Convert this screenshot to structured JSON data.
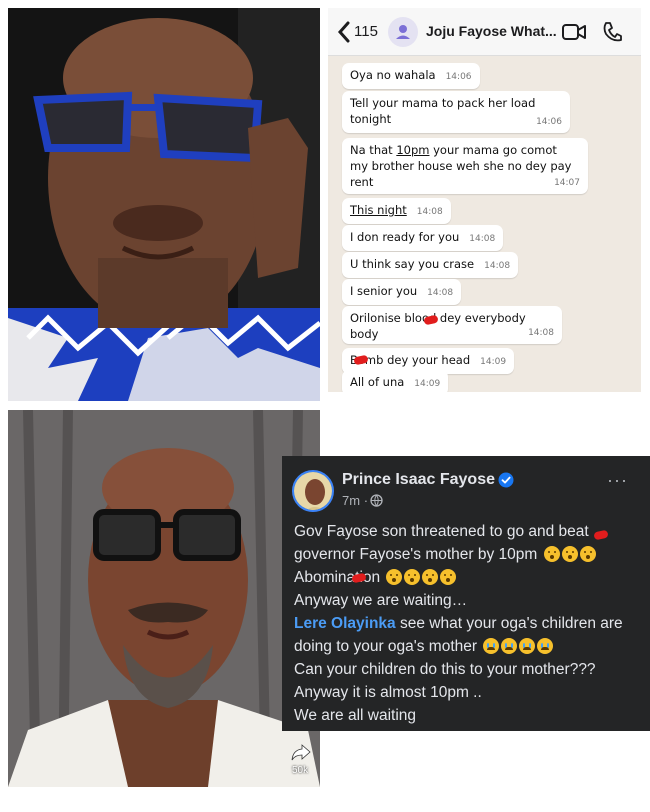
{
  "whatsapp": {
    "back_count": "115",
    "contact_name": "Joju Fayose What...",
    "messages": [
      {
        "text": "Oya no wahala",
        "time": "14:06"
      },
      {
        "text_line1": "Tell your mama to pack her load",
        "text_line2": "tonight",
        "time": "14:06"
      },
      {
        "text_line1_pre": "Na that ",
        "text_line1_u": "10pm",
        "text_line1_post": " your mama go comot",
        "text_line2": "my brother house weh she no dey pay",
        "text_line3": "rent",
        "time": "14:07"
      },
      {
        "text": "This night",
        "time": "14:08"
      },
      {
        "text": "I don ready for you",
        "time": "14:08"
      },
      {
        "text": "U think say you crase",
        "time": "14:08"
      },
      {
        "text": "I senior you",
        "time": "14:08"
      },
      {
        "text": "Orilonise blood dey everybody body",
        "time": "14:08"
      },
      {
        "text": "Bomb dey your head",
        "time": "14:09"
      },
      {
        "text": "All of una",
        "time": "14:09"
      }
    ]
  },
  "facebook": {
    "author": "Prince Isaac Fayose",
    "time": "7m",
    "separator": "·",
    "more": "···",
    "lines": {
      "l1": "Gov Fayose son threatened to go and beat",
      "l2": "governor Fayose's mother by 10pm",
      "l3": "Abomination",
      "l4": "Anyway we are waiting…",
      "l5_link": "Lere Olayinka",
      "l5_rest": " see what your oga's children are",
      "l6": "doing to your oga's mother",
      "l7": "Can your children do this to your mother???",
      "l8": "Anyway it is almost 10pm ..",
      "l9": "We are all waiting"
    }
  },
  "video": {
    "views": "50k"
  },
  "colors": {
    "wa_bg": "#efe9e1",
    "fb_bg": "#242526",
    "fb_link": "#4b9cf5",
    "agbada_blue": "#1d3fbf"
  }
}
